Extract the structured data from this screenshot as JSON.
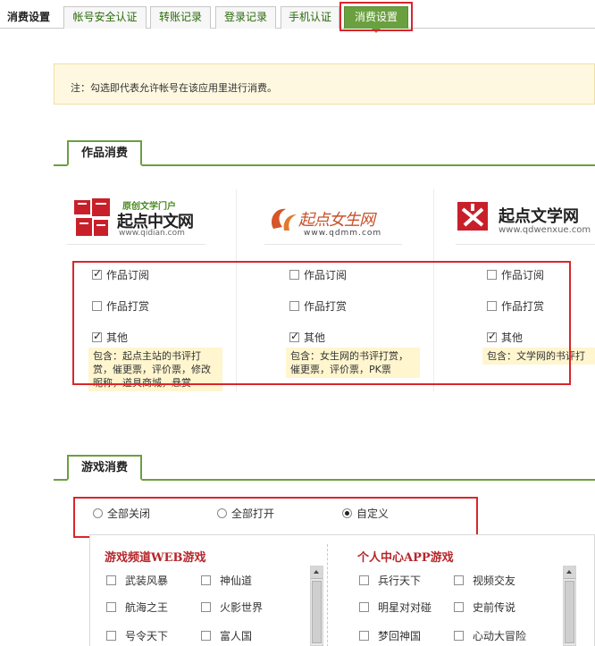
{
  "page_title": "消费设置",
  "tabs": [
    {
      "label": "帐号安全认证"
    },
    {
      "label": "转账记录"
    },
    {
      "label": "登录记录"
    },
    {
      "label": "手机认证"
    },
    {
      "label": "消费设置"
    }
  ],
  "notice": "注：勾选即代表允许帐号在该应用里进行消费。",
  "works_section": {
    "title": "作品消费",
    "sites": [
      {
        "logo_tagline": "原创文学门户",
        "logo_name": "起点中文网",
        "logo_url": "www.qidian.com",
        "options": [
          {
            "label": "作品订阅",
            "checked": true
          },
          {
            "label": "作品打赏",
            "checked": false
          },
          {
            "label": "其他",
            "checked": true
          }
        ],
        "note": "包含：起点主站的书评打赏，催更票，评价票，修改昵称，道具商城，悬赏"
      },
      {
        "logo_name": "起点女生网",
        "logo_url": "www.qdmm.com",
        "options": [
          {
            "label": "作品订阅",
            "checked": false
          },
          {
            "label": "作品打赏",
            "checked": false
          },
          {
            "label": "其他",
            "checked": true
          }
        ],
        "note": "包含：女生网的书评打赏，催更票，评价票，PK票"
      },
      {
        "logo_name": "起点文学网",
        "logo_url": "www.qdwenxue.com",
        "options": [
          {
            "label": "作品订阅",
            "checked": false
          },
          {
            "label": "作品打赏",
            "checked": false
          },
          {
            "label": "其他",
            "checked": true
          }
        ],
        "note": "包含：文学网的书评打"
      }
    ]
  },
  "games_section": {
    "title": "游戏消费",
    "radios": [
      {
        "label": "全部关闭",
        "checked": false
      },
      {
        "label": "全部打开",
        "checked": false
      },
      {
        "label": "自定义",
        "checked": true
      }
    ],
    "web_games": {
      "title": "游戏频道WEB游戏",
      "items": [
        "武装风暴",
        "神仙道",
        "航海之王",
        "火影世界",
        "号令天下",
        "富人国"
      ]
    },
    "app_games": {
      "title": "个人中心APP游戏",
      "items": [
        "兵行天下",
        "视频交友",
        "明星对对碰",
        "史前传说",
        "梦回神国",
        "心动大冒险"
      ]
    }
  },
  "colors": {
    "accent_green": "#6aa03f",
    "highlight_red": "#d9262b",
    "notice_bg": "#fff8e1",
    "game_title_red": "#b5262b"
  }
}
